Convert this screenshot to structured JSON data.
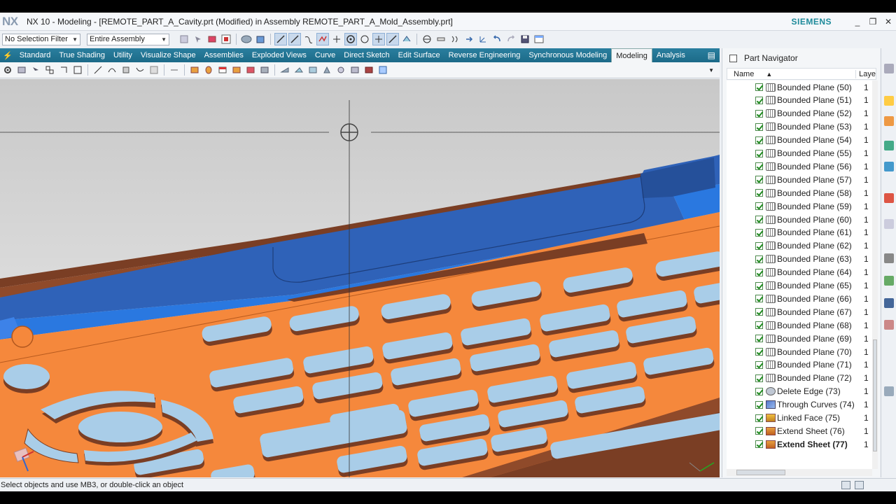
{
  "titlebar": {
    "logo": "NX",
    "title": "NX 10 - Modeling - [REMOTE_PART_A_Cavity.prt (Modified)  in Assembly REMOTE_PART_A_Mold_Assembly.prt]",
    "brand": "SIEMENS",
    "min": "_",
    "restore": "❐",
    "close": "✕"
  },
  "selection": {
    "filter": "No Selection Filter",
    "scope": "Entire Assembly"
  },
  "tabs": [
    "Standard",
    "True Shading",
    "Utility",
    "Visualize Shape",
    "Assemblies",
    "Exploded Views",
    "Curve",
    "Direct Sketch",
    "Edit Surface",
    "Reverse Engineering",
    "Synchronous Modeling",
    "Modeling",
    "Analysis"
  ],
  "active_tab": "Modeling",
  "status": {
    "message": "Select objects and use MB3, or double-click an object"
  },
  "navigator": {
    "title": "Part Navigator",
    "col_name": "Name",
    "col_layer": "Laye",
    "sort_icon": "sort-ascending-icon",
    "items": [
      {
        "label": "Bounded Plane (50)",
        "layer": "1",
        "icon": "bounded-plane-icon"
      },
      {
        "label": "Bounded Plane (51)",
        "layer": "1",
        "icon": "bounded-plane-icon"
      },
      {
        "label": "Bounded Plane (52)",
        "layer": "1",
        "icon": "bounded-plane-icon"
      },
      {
        "label": "Bounded Plane (53)",
        "layer": "1",
        "icon": "bounded-plane-icon"
      },
      {
        "label": "Bounded Plane (54)",
        "layer": "1",
        "icon": "bounded-plane-icon"
      },
      {
        "label": "Bounded Plane (55)",
        "layer": "1",
        "icon": "bounded-plane-icon"
      },
      {
        "label": "Bounded Plane (56)",
        "layer": "1",
        "icon": "bounded-plane-icon"
      },
      {
        "label": "Bounded Plane (57)",
        "layer": "1",
        "icon": "bounded-plane-icon"
      },
      {
        "label": "Bounded Plane (58)",
        "layer": "1",
        "icon": "bounded-plane-icon"
      },
      {
        "label": "Bounded Plane (59)",
        "layer": "1",
        "icon": "bounded-plane-icon"
      },
      {
        "label": "Bounded Plane (60)",
        "layer": "1",
        "icon": "bounded-plane-icon"
      },
      {
        "label": "Bounded Plane (61)",
        "layer": "1",
        "icon": "bounded-plane-icon"
      },
      {
        "label": "Bounded Plane (62)",
        "layer": "1",
        "icon": "bounded-plane-icon"
      },
      {
        "label": "Bounded Plane (63)",
        "layer": "1",
        "icon": "bounded-plane-icon"
      },
      {
        "label": "Bounded Plane (64)",
        "layer": "1",
        "icon": "bounded-plane-icon"
      },
      {
        "label": "Bounded Plane (65)",
        "layer": "1",
        "icon": "bounded-plane-icon"
      },
      {
        "label": "Bounded Plane (66)",
        "layer": "1",
        "icon": "bounded-plane-icon"
      },
      {
        "label": "Bounded Plane (67)",
        "layer": "1",
        "icon": "bounded-plane-icon"
      },
      {
        "label": "Bounded Plane (68)",
        "layer": "1",
        "icon": "bounded-plane-icon"
      },
      {
        "label": "Bounded Plane (69)",
        "layer": "1",
        "icon": "bounded-plane-icon"
      },
      {
        "label": "Bounded Plane (70)",
        "layer": "1",
        "icon": "bounded-plane-icon"
      },
      {
        "label": "Bounded Plane (71)",
        "layer": "1",
        "icon": "bounded-plane-icon"
      },
      {
        "label": "Bounded Plane (72)",
        "layer": "1",
        "icon": "bounded-plane-icon"
      },
      {
        "label": "Delete Edge (73)",
        "layer": "1",
        "icon": "delete-edge-icon"
      },
      {
        "label": "Through Curves (74)",
        "layer": "1",
        "icon": "through-curves-icon"
      },
      {
        "label": "Linked Face (75)",
        "layer": "1",
        "icon": "linked-face-icon"
      },
      {
        "label": "Extend Sheet (76)",
        "layer": "1",
        "icon": "extend-sheet-icon"
      },
      {
        "label": "Extend Sheet (77)",
        "layer": "1",
        "icon": "extend-sheet-icon",
        "current": true
      }
    ]
  },
  "colors": {
    "ribbon": "#1c6a88",
    "model_orange": "#f5883c",
    "model_blue": "#2f62b8",
    "key_light_blue": "#a9cde8",
    "key_brown": "#7a3e24"
  }
}
